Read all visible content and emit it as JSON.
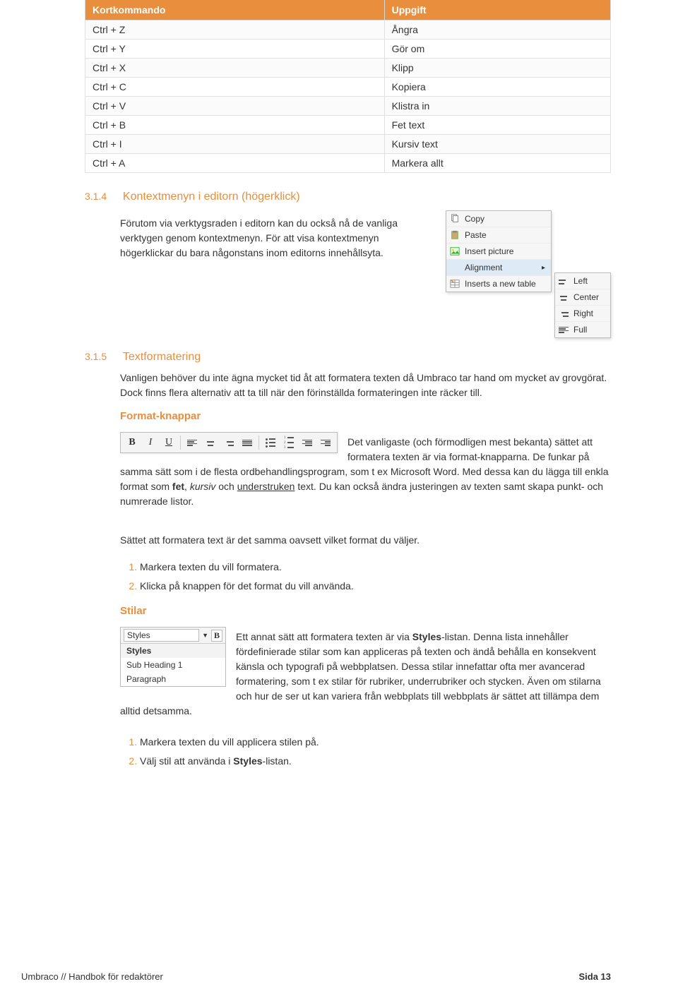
{
  "table": {
    "head_shortcut": "Kortkommando",
    "head_task": "Uppgift",
    "rows": [
      {
        "k": "Ctrl + Z",
        "v": "Ångra"
      },
      {
        "k": "Ctrl + Y",
        "v": "Gör om"
      },
      {
        "k": "Ctrl + X",
        "v": "Klipp"
      },
      {
        "k": "Ctrl + C",
        "v": "Kopiera"
      },
      {
        "k": "Ctrl + V",
        "v": "Klistra in"
      },
      {
        "k": "Ctrl + B",
        "v": "Fet text"
      },
      {
        "k": "Ctrl + I",
        "v": "Kursiv text"
      },
      {
        "k": "Ctrl + A",
        "v": "Markera allt"
      }
    ]
  },
  "sec314": {
    "num": "3.1.4",
    "title": "Kontextmenyn i editorn (högerklick)",
    "body": "Förutom via verktygsraden i editorn kan du också nå de vanliga verktygen genom kontextmenyn. För att visa kontextmenyn högerklickar du bara någonstans inom editorns innehållsyta."
  },
  "ctx": {
    "main": [
      {
        "icon": "copy-icon",
        "label": "Copy"
      },
      {
        "icon": "paste-icon",
        "label": "Paste"
      },
      {
        "icon": "image-icon",
        "label": "Insert picture"
      },
      {
        "icon": "align-icon",
        "label": "Alignment",
        "arrow": "▸",
        "hover": true
      },
      {
        "icon": "table-icon",
        "label": "Inserts a new table"
      }
    ],
    "sub": [
      {
        "label": "Left"
      },
      {
        "label": "Center"
      },
      {
        "label": "Right"
      },
      {
        "label": "Full"
      }
    ]
  },
  "sec315": {
    "num": "3.1.5",
    "title": "Textformatering",
    "body": "Vanligen behöver du inte ägna mycket tid åt att formatera texten då Umbraco tar hand om mycket av grovgörat. Dock finns flera alternativ att ta till när den förinställda formateringen inte räcker till."
  },
  "formatknappar": {
    "head": "Format-knappar",
    "text_lead": "Det vanligaste (och förmodligen mest bekanta) sättet att formatera texten är via format-knapparna. De funkar på samma sätt som i de ",
    "text_cont": "flesta ordbehandlingsprogram, som t ex Microsoft Word. Med dessa kan du lägga till enkla format som ",
    "bold": "fet",
    "sep1": ", ",
    "italic": "kursiv",
    "sep2": " och ",
    "underline": "understruken",
    "text_end": " text. Du kan också ändra justeringen av texten samt skapa punkt- och numrerade listor.",
    "para2": "Sättet att formatera text är det samma oavsett vilket format du väljer.",
    "steps": [
      "Markera texten du vill formatera.",
      "Klicka på knappen för det format du vill använda."
    ]
  },
  "stilar": {
    "head": "Stilar",
    "dd_value": "Styles",
    "opts": [
      "Styles",
      "Sub Heading 1",
      "Paragraph"
    ],
    "text1": "Ett annat sätt att formatera texten är via ",
    "b1": "Styles",
    "text2": "-listan. Denna lista innehåller fördefinierade stilar som kan appliceras på texten och ändå behålla en konsekvent känsla och typografi på webbplatsen. Dessa stilar innefattar ofta mer avancerad formatering, som t ex stilar för rubriker, underrubriker och stycken. Även om stilarna och hur de ser ut kan variera från webbplats till webbplats är sättet att tillämpa dem alltid detsamma.",
    "steps": [
      "Markera texten du vill applicera stilen på.",
      "Välj stil att använda i Styles-listan."
    ],
    "step2_pre": "Välj stil att använda i ",
    "step2_b": "Styles",
    "step2_post": "-listan."
  },
  "footer": {
    "left": "Umbraco // Handbok för redaktörer",
    "right": "Sida 13"
  }
}
